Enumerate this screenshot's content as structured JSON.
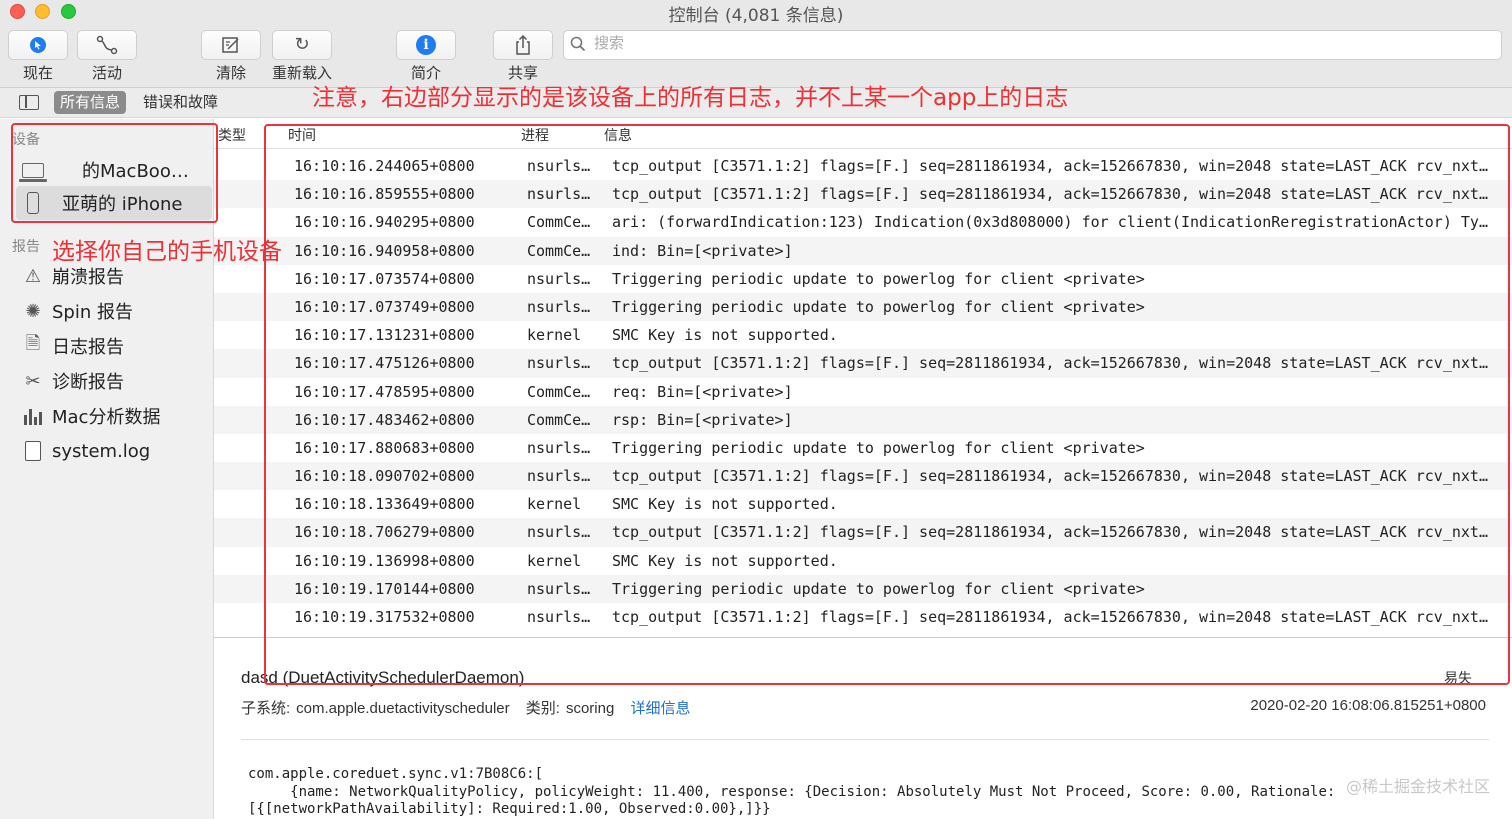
{
  "window": {
    "title": "控制台 (4,081 条信息)"
  },
  "toolbar": {
    "now_label": "现在",
    "activity_label": "活动",
    "clear_label": "清除",
    "reload_label": "重新载入",
    "info_label": "简介",
    "share_label": "共享",
    "search_placeholder": "搜索"
  },
  "filters": {
    "all_label": "所有信息",
    "errors_label": "错误和故障"
  },
  "sidebar": {
    "devices_heading": "设备",
    "devices": [
      {
        "label": "的MacBoo…",
        "icon": "laptop-icon"
      },
      {
        "label": "亚萌的 iPhone",
        "icon": "iphone-icon"
      }
    ],
    "reports_heading": "报告",
    "reports": [
      {
        "label": "崩溃报告",
        "icon": "warning-icon"
      },
      {
        "label": "Spin 报告",
        "icon": "spin-icon"
      },
      {
        "label": "日志报告",
        "icon": "document-icon"
      },
      {
        "label": "诊断报告",
        "icon": "tools-icon"
      },
      {
        "label": "Mac分析数据",
        "icon": "chart-bars-icon"
      },
      {
        "label": "system.log",
        "icon": "file-icon"
      }
    ]
  },
  "table": {
    "columns": {
      "type": "类型",
      "time": "时间",
      "process": "进程",
      "message": "信息"
    },
    "rows": [
      {
        "time": "16:10:16.244065+0800",
        "process": "nsurls…",
        "message": "tcp_output [C3571.1:2] flags=[F.] seq=2811861934, ack=152667830, win=2048 state=LAST_ACK rcv_nxt…"
      },
      {
        "time": "16:10:16.859555+0800",
        "process": "nsurls…",
        "message": "tcp_output [C3571.1:2] flags=[F.] seq=2811861934, ack=152667830, win=2048 state=LAST_ACK rcv_nxt…"
      },
      {
        "time": "16:10:16.940295+0800",
        "process": "CommCe…",
        "message": "ari: (forwardIndication:123) Indication(0x3d808000) for client(IndicationReregistrationActor) Ty…"
      },
      {
        "time": "16:10:16.940958+0800",
        "process": "CommCe…",
        "message": "ind: Bin=[<private>]"
      },
      {
        "time": "16:10:17.073574+0800",
        "process": "nsurls…",
        "message": "Triggering periodic update to powerlog for client <private>"
      },
      {
        "time": "16:10:17.073749+0800",
        "process": "nsurls…",
        "message": "Triggering periodic update to powerlog for client <private>"
      },
      {
        "time": "16:10:17.131231+0800",
        "process": "kernel",
        "message": "SMC Key      is not supported."
      },
      {
        "time": "16:10:17.475126+0800",
        "process": "nsurls…",
        "message": "tcp_output [C3571.1:2] flags=[F.] seq=2811861934, ack=152667830, win=2048 state=LAST_ACK rcv_nxt…"
      },
      {
        "time": "16:10:17.478595+0800",
        "process": "CommCe…",
        "message": "req: Bin=[<private>]"
      },
      {
        "time": "16:10:17.483462+0800",
        "process": "CommCe…",
        "message": "rsp: Bin=[<private>]"
      },
      {
        "time": "16:10:17.880683+0800",
        "process": "nsurls…",
        "message": "Triggering periodic update to powerlog for client <private>"
      },
      {
        "time": "16:10:18.090702+0800",
        "process": "nsurls…",
        "message": "tcp_output [C3571.1:2] flags=[F.] seq=2811861934, ack=152667830, win=2048 state=LAST_ACK rcv_nxt…"
      },
      {
        "time": "16:10:18.133649+0800",
        "process": "kernel",
        "message": "SMC Key      is not supported."
      },
      {
        "time": "16:10:18.706279+0800",
        "process": "nsurls…",
        "message": "tcp_output [C3571.1:2] flags=[F.] seq=2811861934, ack=152667830, win=2048 state=LAST_ACK rcv_nxt…"
      },
      {
        "time": "16:10:19.136998+0800",
        "process": "kernel",
        "message": "SMC Key      is not supported."
      },
      {
        "time": "16:10:19.170144+0800",
        "process": "nsurls…",
        "message": "Triggering periodic update to powerlog for client <private>"
      },
      {
        "time": "16:10:19.317532+0800",
        "process": "nsurls…",
        "message": "tcp_output [C3571.1:2] flags=[F.] seq=2811861934, ack=152667830, win=2048 state=LAST_ACK rcv_nxt…"
      }
    ]
  },
  "detail": {
    "title": "dasd (DuetActivitySchedulerDaemon)",
    "right_label": "易失",
    "subsystem_label": "子系统:",
    "subsystem_value": "com.apple.duetactivityscheduler",
    "category_label": "类别:",
    "category_value": "scoring",
    "details_link": "详细信息",
    "timestamp": "2020-02-20 16:08:06.815251+0800",
    "body": "com.apple.coreduet.sync.v1:7B08C6:[\n     {name: NetworkQualityPolicy, policyWeight: 11.400, response: {Decision: Absolutely Must Not Proceed, Score: 0.00, Rationale:\n[{[networkPathAvailability]: Required:1.00, Observed:0.00},]}}"
  },
  "annotations": {
    "top_note": "注意，右边部分显示的是该设备上的所有日志，并不上某一个app上的日志",
    "side_note": "选择你自己的手机设备",
    "color": "#e8343c"
  },
  "watermark": "@稀土掘金技术社区"
}
